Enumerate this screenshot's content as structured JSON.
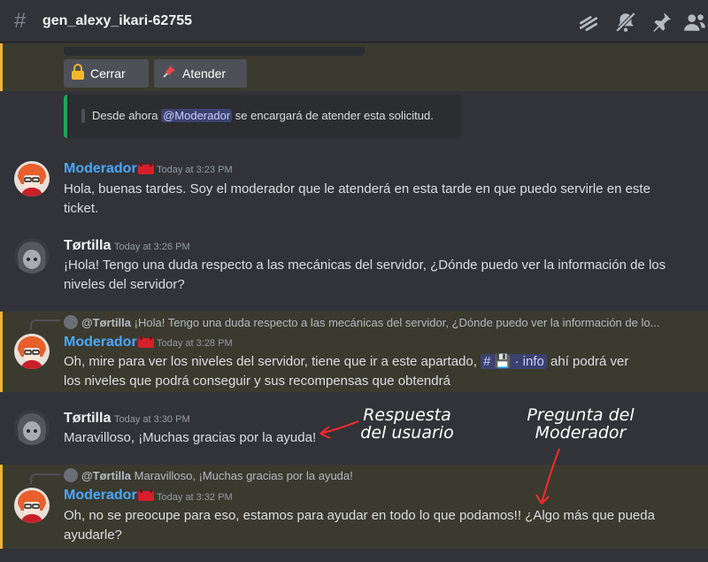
{
  "header": {
    "channel": "gen_alexy_ikari-62755"
  },
  "buttons": {
    "close": "Cerrar",
    "attend": "Atender"
  },
  "embed": {
    "prefix": "Desde ahora",
    "mention": "@Moderador",
    "suffix": "se encargará de atender esta solicitud."
  },
  "messages": [
    {
      "author": "Moderador",
      "time": "Today at 3:23 PM",
      "text": "Hola, buenas tardes. Soy el moderador que le atenderá en esta tarde en que puedo servirle en este ticket."
    },
    {
      "author": "Tørtilla",
      "time": "Today at 3:26 PM",
      "text": "¡Hola! Tengo una duda respecto a las mecánicas del servidor, ¿Dónde puedo ver la información de los niveles del servidor?"
    },
    {
      "reply_author": "@Tørtilla",
      "reply_text": "¡Hola! Tengo una duda respecto a las mecánicas del servidor, ¿Dónde puedo ver la información de lo...",
      "author": "Moderador",
      "time": "Today at 3:28 PM",
      "text_a": "Oh, mire para ver los niveles del servidor, tiene que ir a este apartado,",
      "channel_mention": "info",
      "text_b": "ahí podrá ver",
      "text_c": "los niveles que podrá conseguir y sus recompensas que obtendrá"
    },
    {
      "author": "Tørtilla",
      "time": "Today at 3:30 PM",
      "text": "Maravilloso, ¡Muchas gracias por la ayuda!"
    },
    {
      "reply_author": "@Tørtilla",
      "reply_text": "Maravilloso, ¡Muchas gracias por la ayuda!",
      "author": "Moderador",
      "time": "Today at 3:32 PM",
      "text": "Oh, no se preocupe para eso, estamos para ayudar en todo lo que podamos!! ¿Algo más que pueda ayudarle?"
    }
  ],
  "annotations": {
    "user": [
      "Respuesta",
      "del usuario"
    ],
    "mod": [
      "Pregunta del",
      "Moderador"
    ]
  },
  "colors": {
    "moderator": "#4aa8ff",
    "highlight_bar": "#f0b232",
    "embed_bar": "#23a55a"
  }
}
